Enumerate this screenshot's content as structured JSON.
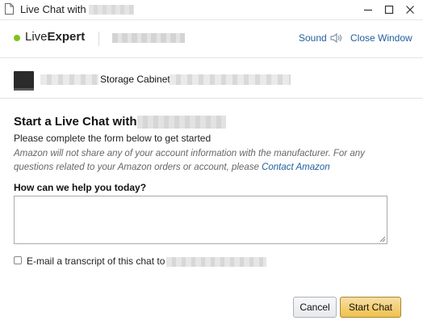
{
  "window": {
    "title": "Live Chat with",
    "icons": {
      "document": "document-icon",
      "minimize": "minimize-icon",
      "maximize": "maximize-icon",
      "close": "close-icon"
    }
  },
  "header": {
    "brand_light": "Live",
    "brand_bold": "Expert",
    "sound_label": "Sound",
    "close_window_label": "Close Window",
    "accent_color": "#7fc31c",
    "link_color": "#1f5f9c"
  },
  "product": {
    "name": "Storage Cabinet"
  },
  "form": {
    "heading": "Start a Live Chat with",
    "subheading": "Please complete the form below to get started",
    "disclaimer": "Amazon will not share any of your account information with the manufacturer. For any questions related to your Amazon orders or account, please ",
    "contact_link": "Contact Amazon",
    "question_label": "How can we help you today?",
    "question_value": "",
    "transcript_label": "E-mail a transcript of this chat to",
    "transcript_checked": false
  },
  "buttons": {
    "cancel": "Cancel",
    "start_chat": "Start Chat"
  }
}
